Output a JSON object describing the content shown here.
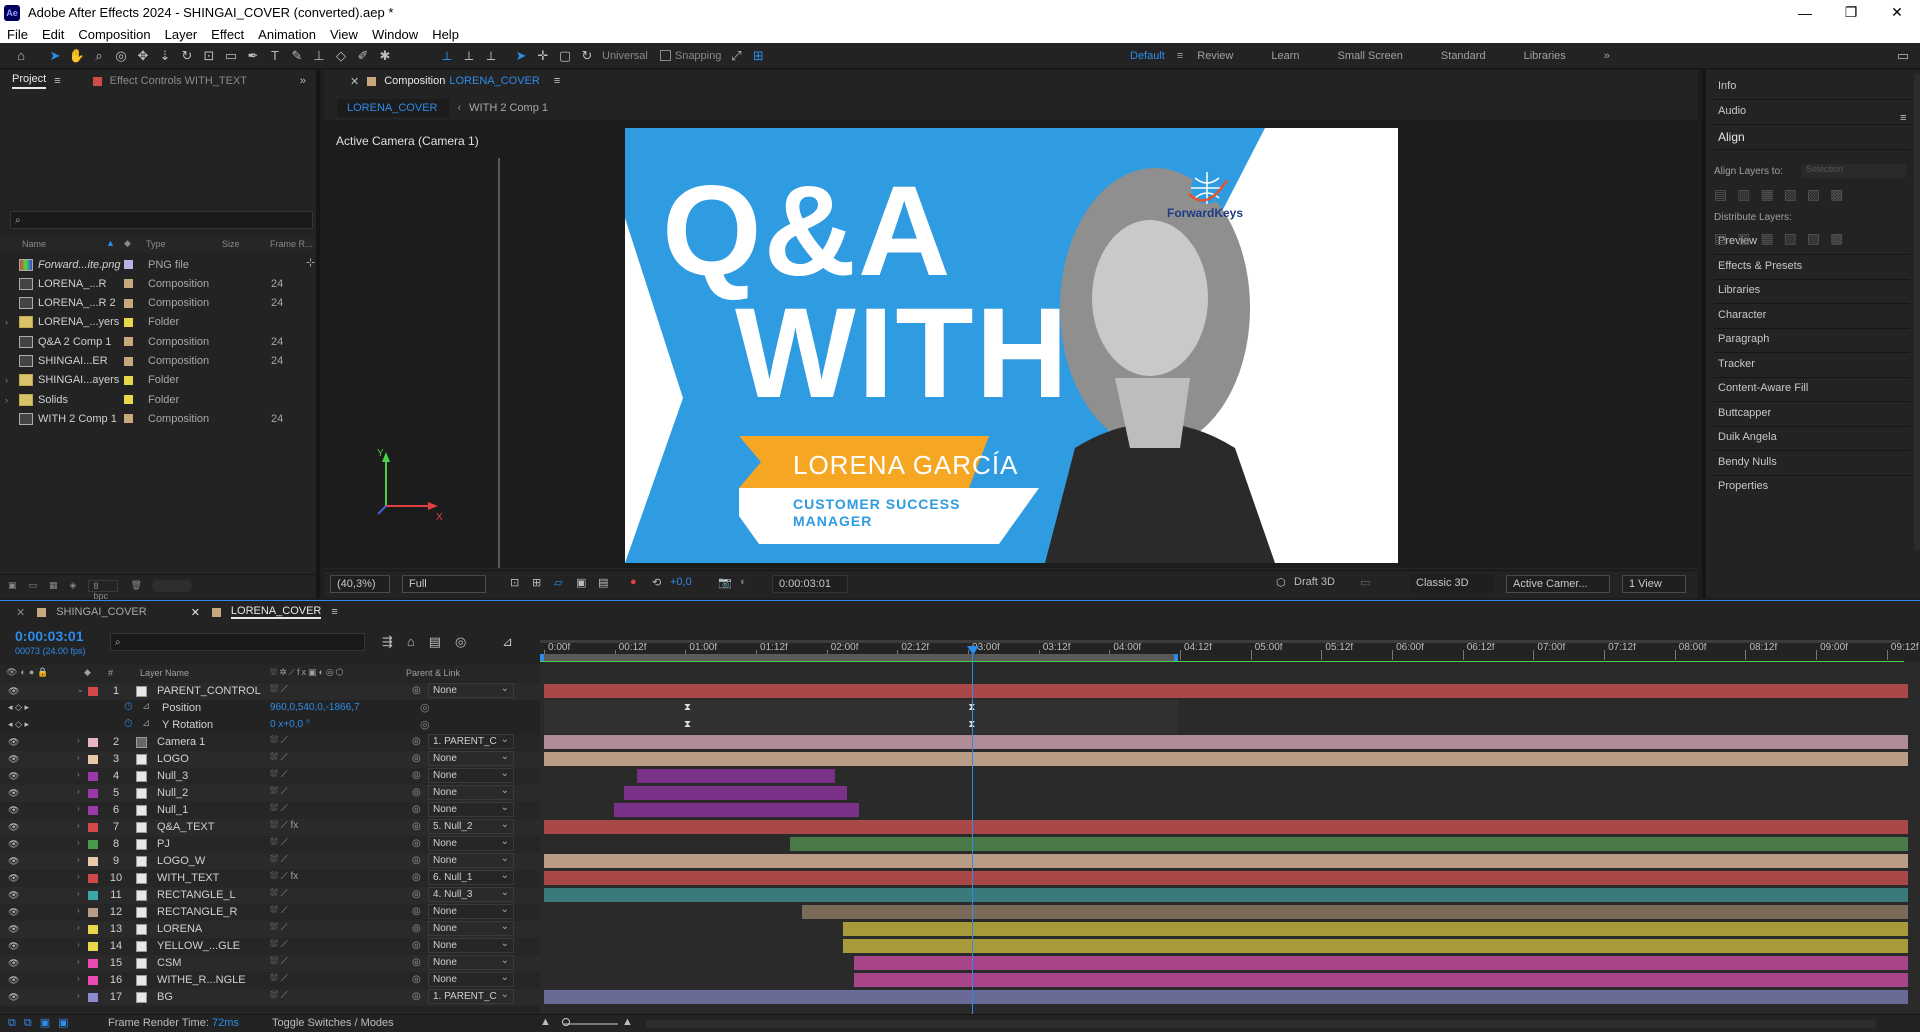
{
  "window": {
    "title": "Adobe After Effects 2024 - SHINGAI_COVER (converted).aep *",
    "app_badge": "Ae",
    "minimize": "—",
    "maximize": "❐",
    "close": "✕"
  },
  "menu": [
    "File",
    "Edit",
    "Composition",
    "Layer",
    "Effect",
    "Animation",
    "View",
    "Window",
    "Help"
  ],
  "toolbar": {
    "universal": "Universal",
    "snapping": "Snapping"
  },
  "workspaces": [
    "Default",
    "Review",
    "Learn",
    "Small Screen",
    "Standard",
    "Libraries"
  ],
  "project_panel": {
    "tab_project": "Project",
    "tab_effect_controls": "Effect Controls WITH_TEXT",
    "columns": {
      "name": "Name",
      "type": "Type",
      "size": "Size",
      "frame": "Frame R..."
    },
    "items": [
      {
        "name": "Forward...ite.png",
        "type": "PNG file",
        "frames": "",
        "color": "#b4b4e6",
        "kind": "png"
      },
      {
        "name": "LORENA_...R",
        "type": "Composition",
        "frames": "24",
        "color": "#c8a87c",
        "kind": "comp"
      },
      {
        "name": "LORENA_...R 2",
        "type": "Composition",
        "frames": "24",
        "color": "#c8a87c",
        "kind": "comp"
      },
      {
        "name": "LORENA_...yers",
        "type": "Folder",
        "frames": "",
        "color": "#e8d74a",
        "kind": "folder"
      },
      {
        "name": "Q&A 2 Comp 1",
        "type": "Composition",
        "frames": "24",
        "color": "#c8a87c",
        "kind": "comp"
      },
      {
        "name": "SHINGAI...ER",
        "type": "Composition",
        "frames": "24",
        "color": "#c8a87c",
        "kind": "comp"
      },
      {
        "name": "SHINGAI...ayers",
        "type": "Folder",
        "frames": "",
        "color": "#e8d74a",
        "kind": "folder"
      },
      {
        "name": "Solids",
        "type": "Folder",
        "frames": "",
        "color": "#e8d74a",
        "kind": "folder"
      },
      {
        "name": "WITH 2 Comp 1",
        "type": "Composition",
        "frames": "24",
        "color": "#c8a87c",
        "kind": "comp"
      }
    ],
    "bpc": "8 bpc"
  },
  "comp_panel": {
    "tab_prefix": "Composition",
    "tab_name": "LORENA_COVER",
    "sub_tabs": [
      "LORENA_COVER",
      "WITH 2 Comp 1"
    ],
    "camera_label": "Active Camera (Camera 1)",
    "artwork": {
      "line1": "Q&A",
      "line2": "WITH",
      "name": "LORENA GARCÍA",
      "role1": "CUSTOMER SUCCESS",
      "role2": "MANAGER",
      "logo": "ForwardKeys"
    },
    "footer": {
      "zoom": "(40,3%)",
      "resolution": "Full",
      "exposure": "+0,0",
      "timecode": "0:00:03:01",
      "draft3d": "Draft 3D",
      "renderer": "Classic 3D",
      "view": "Active Camer...",
      "views": "1 View"
    }
  },
  "right_panel": {
    "items": [
      "Info",
      "Audio",
      "Align",
      "Preview",
      "Effects & Presets",
      "Libraries",
      "Character",
      "Paragraph",
      "Tracker",
      "Content-Aware Fill",
      "Buttcapper",
      "Duik Angela",
      "Bendy Nulls",
      "Properties"
    ],
    "align_layers_to": "Align Layers to:",
    "align_target": "Selection",
    "distribute": "Distribute Layers:"
  },
  "timeline": {
    "tabs": [
      "SHINGAI_COVER",
      "LORENA_COVER"
    ],
    "timecode": "0:00:03:01",
    "timecode_sub": "00073 (24.00 fps)",
    "columns": {
      "layer_name": "Layer Name",
      "parent": "Parent & Link",
      "hash": "#"
    },
    "ruler_labels": [
      "0:00f",
      "00:12f",
      "01:00f",
      "01:12f",
      "02:00f",
      "02:12f",
      "03:00f",
      "03:12f",
      "04:00f",
      "04:12f",
      "05:00f",
      "05:12f",
      "06:00f",
      "06:12f",
      "07:00f",
      "07:12f",
      "08:00f",
      "08:12f",
      "09:00f",
      "09:12f"
    ],
    "properties": [
      {
        "name": "Position",
        "value": "960,0,540,0,-1866,7"
      },
      {
        "name": "Y Rotation",
        "value": "0 x+0,0 °"
      }
    ],
    "layers": [
      {
        "num": "1",
        "name": "PARENT_CONTROL",
        "color": "#d04a4a",
        "parent": "None",
        "fx": false,
        "bar_start": 0.0,
        "bar_end": 1.0,
        "bar_color": "#a84848"
      },
      {
        "num": "2",
        "name": "Camera 1",
        "color": "#e8b4c8",
        "parent": "1. PARENT_C",
        "fx": false,
        "bar_start": 0.0,
        "bar_end": 1.0,
        "bar_color": "#b08c96"
      },
      {
        "num": "3",
        "name": "LOGO",
        "color": "#e8c8a8",
        "parent": "None",
        "fx": false,
        "bar_start": 0.0,
        "bar_end": 1.0,
        "bar_color": "#b89c86"
      },
      {
        "num": "4",
        "name": "Null_3",
        "color": "#9a3aa8",
        "parent": "None",
        "fx": false,
        "bar_start": 0.068,
        "bar_end": 0.213,
        "bar_color": "#7a3288"
      },
      {
        "num": "5",
        "name": "Null_2",
        "color": "#9a3aa8",
        "parent": "None",
        "fx": false,
        "bar_start": 0.059,
        "bar_end": 0.222,
        "bar_color": "#7a3288"
      },
      {
        "num": "6",
        "name": "Null_1",
        "color": "#9a3aa8",
        "parent": "None",
        "fx": false,
        "bar_start": 0.051,
        "bar_end": 0.231,
        "bar_color": "#7a3288"
      },
      {
        "num": "7",
        "name": "Q&A_TEXT",
        "color": "#d04a4a",
        "parent": "5. Null_2",
        "fx": true,
        "bar_start": 0.0,
        "bar_end": 1.0,
        "bar_color": "#a84848"
      },
      {
        "num": "8",
        "name": "PJ",
        "color": "#4a9a4a",
        "parent": "None",
        "fx": false,
        "bar_start": 0.18,
        "bar_end": 1.0,
        "bar_color": "#4a7a4a"
      },
      {
        "num": "9",
        "name": "LOGO_W",
        "color": "#e8c8a8",
        "parent": "None",
        "fx": false,
        "bar_start": 0.0,
        "bar_end": 1.0,
        "bar_color": "#b89c86"
      },
      {
        "num": "10",
        "name": "WITH_TEXT",
        "color": "#d04a4a",
        "parent": "6. Null_1",
        "fx": true,
        "bar_start": 0.0,
        "bar_end": 1.0,
        "bar_color": "#a84848"
      },
      {
        "num": "11",
        "name": "RECTANGLE_L",
        "color": "#3aa8a8",
        "parent": "4. Null_3",
        "fx": false,
        "bar_start": 0.0,
        "bar_end": 1.0,
        "bar_color": "#3a7a7a"
      },
      {
        "num": "12",
        "name": "RECTANGLE_R",
        "color": "#b89c86",
        "parent": "None",
        "fx": false,
        "bar_start": 0.189,
        "bar_end": 1.0,
        "bar_color": "#7a6a5a"
      },
      {
        "num": "13",
        "name": "LORENA",
        "color": "#e8d74a",
        "parent": "None",
        "fx": false,
        "bar_start": 0.219,
        "bar_end": 1.0,
        "bar_color": "#a89a3a"
      },
      {
        "num": "14",
        "name": "YELLOW_...GLE",
        "color": "#e8d74a",
        "parent": "None",
        "fx": false,
        "bar_start": 0.219,
        "bar_end": 1.0,
        "bar_color": "#a89a3a"
      },
      {
        "num": "15",
        "name": "CSM",
        "color": "#e84ab0",
        "parent": "None",
        "fx": false,
        "bar_start": 0.227,
        "bar_end": 1.0,
        "bar_color": "#a8448a"
      },
      {
        "num": "16",
        "name": "WITHE_R...NGLE",
        "color": "#e84ab0",
        "parent": "None",
        "fx": false,
        "bar_start": 0.227,
        "bar_end": 1.0,
        "bar_color": "#a8448a"
      },
      {
        "num": "17",
        "name": "BG",
        "color": "#8a8ad0",
        "parent": "1. PARENT_C",
        "fx": false,
        "bar_start": 0.0,
        "bar_end": 1.0,
        "bar_color": "#6a6a96"
      }
    ],
    "playhead_fraction": 0.314,
    "work_area_end_fraction": 0.465,
    "footer": {
      "frame_render_label": "Frame Render Time:",
      "frame_render_value": "72ms",
      "toggle": "Toggle Switches / Modes"
    }
  },
  "colors": {
    "accent": "#2d8ceb",
    "artwork_blue": "#2f9be0",
    "artwork_yellow": "#f5a623"
  }
}
